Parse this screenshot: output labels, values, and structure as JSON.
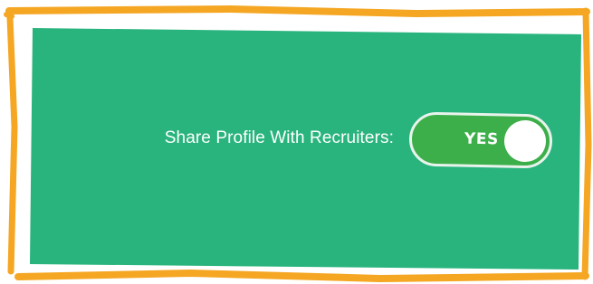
{
  "colors": {
    "frame": "#f5a623",
    "panel": "#29b47d",
    "toggle_on": "#3caf4a",
    "text": "#ffffff"
  },
  "setting": {
    "label": "Share Profile With Recruiters:",
    "toggle_state_text": "YES",
    "enabled": true
  }
}
